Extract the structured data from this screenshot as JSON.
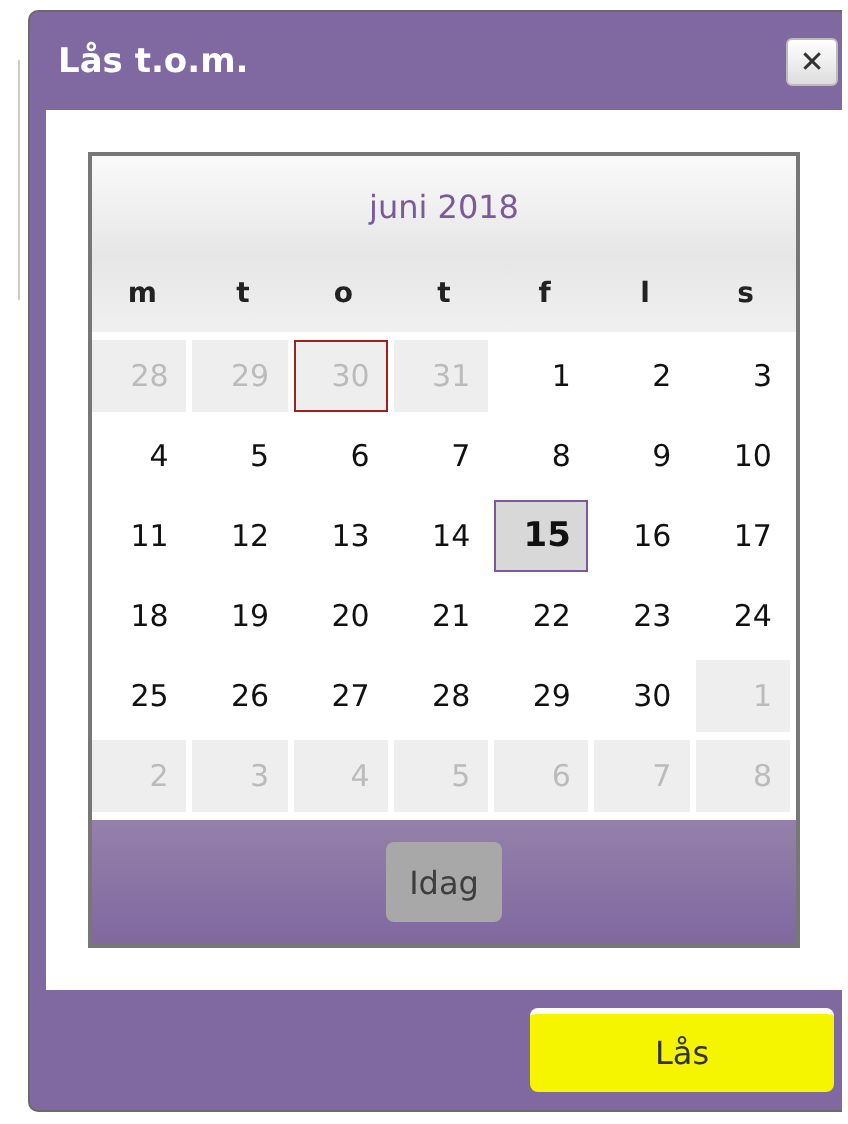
{
  "dialog": {
    "title": "Lås t.o.m.",
    "close_label": "✕"
  },
  "calendar": {
    "month": "juni 2018",
    "weekdays": [
      "m",
      "t",
      "o",
      "t",
      "f",
      "l",
      "s"
    ],
    "weeks": [
      [
        {
          "label": "28",
          "other_month": true,
          "selected": false,
          "marked": false
        },
        {
          "label": "29",
          "other_month": true,
          "selected": false,
          "marked": false
        },
        {
          "label": "30",
          "other_month": true,
          "selected": false,
          "marked": true
        },
        {
          "label": "31",
          "other_month": true,
          "selected": false,
          "marked": false
        },
        {
          "label": "1",
          "other_month": false,
          "selected": false,
          "marked": false
        },
        {
          "label": "2",
          "other_month": false,
          "selected": false,
          "marked": false
        },
        {
          "label": "3",
          "other_month": false,
          "selected": false,
          "marked": false
        }
      ],
      [
        {
          "label": "4",
          "other_month": false,
          "selected": false,
          "marked": false
        },
        {
          "label": "5",
          "other_month": false,
          "selected": false,
          "marked": false
        },
        {
          "label": "6",
          "other_month": false,
          "selected": false,
          "marked": false
        },
        {
          "label": "7",
          "other_month": false,
          "selected": false,
          "marked": false
        },
        {
          "label": "8",
          "other_month": false,
          "selected": false,
          "marked": false
        },
        {
          "label": "9",
          "other_month": false,
          "selected": false,
          "marked": false
        },
        {
          "label": "10",
          "other_month": false,
          "selected": false,
          "marked": false
        }
      ],
      [
        {
          "label": "11",
          "other_month": false,
          "selected": false,
          "marked": false
        },
        {
          "label": "12",
          "other_month": false,
          "selected": false,
          "marked": false
        },
        {
          "label": "13",
          "other_month": false,
          "selected": false,
          "marked": false
        },
        {
          "label": "14",
          "other_month": false,
          "selected": false,
          "marked": false
        },
        {
          "label": "15",
          "other_month": false,
          "selected": true,
          "marked": false
        },
        {
          "label": "16",
          "other_month": false,
          "selected": false,
          "marked": false
        },
        {
          "label": "17",
          "other_month": false,
          "selected": false,
          "marked": false
        }
      ],
      [
        {
          "label": "18",
          "other_month": false,
          "selected": false,
          "marked": false
        },
        {
          "label": "19",
          "other_month": false,
          "selected": false,
          "marked": false
        },
        {
          "label": "20",
          "other_month": false,
          "selected": false,
          "marked": false
        },
        {
          "label": "21",
          "other_month": false,
          "selected": false,
          "marked": false
        },
        {
          "label": "22",
          "other_month": false,
          "selected": false,
          "marked": false
        },
        {
          "label": "23",
          "other_month": false,
          "selected": false,
          "marked": false
        },
        {
          "label": "24",
          "other_month": false,
          "selected": false,
          "marked": false
        }
      ],
      [
        {
          "label": "25",
          "other_month": false,
          "selected": false,
          "marked": false
        },
        {
          "label": "26",
          "other_month": false,
          "selected": false,
          "marked": false
        },
        {
          "label": "27",
          "other_month": false,
          "selected": false,
          "marked": false
        },
        {
          "label": "28",
          "other_month": false,
          "selected": false,
          "marked": false
        },
        {
          "label": "29",
          "other_month": false,
          "selected": false,
          "marked": false
        },
        {
          "label": "30",
          "other_month": false,
          "selected": false,
          "marked": false
        },
        {
          "label": "1",
          "other_month": true,
          "selected": false,
          "marked": false
        }
      ],
      [
        {
          "label": "2",
          "other_month": true,
          "selected": false,
          "marked": false
        },
        {
          "label": "3",
          "other_month": true,
          "selected": false,
          "marked": false
        },
        {
          "label": "4",
          "other_month": true,
          "selected": false,
          "marked": false
        },
        {
          "label": "5",
          "other_month": true,
          "selected": false,
          "marked": false
        },
        {
          "label": "6",
          "other_month": true,
          "selected": false,
          "marked": false
        },
        {
          "label": "7",
          "other_month": true,
          "selected": false,
          "marked": false
        },
        {
          "label": "8",
          "other_month": true,
          "selected": false,
          "marked": false
        }
      ]
    ],
    "today_button": {
      "label": "Idag",
      "disabled": true
    }
  },
  "buttons": [
    {
      "label": "Lås"
    }
  ]
}
